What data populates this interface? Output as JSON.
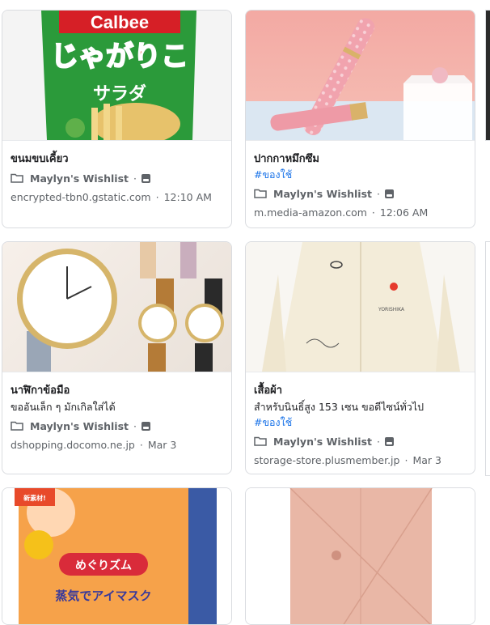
{
  "cards": [
    {
      "title": "ขนมขบเคี้ยว",
      "list_name": "Maylyn's Wishlist",
      "source": "encrypted-tbn0.gstatic.com",
      "time": "12:10 AM"
    },
    {
      "title": "ปากกาหมึกซึม",
      "tag": "#ของใช้",
      "list_name": "Maylyn's Wishlist",
      "source": "m.media-amazon.com",
      "time": "12:06 AM"
    },
    {
      "title": "นาฬิกาข้อมือ",
      "desc": "ขออันเล็ก ๆ มักเกิลใส่ได้",
      "list_name": "Maylyn's Wishlist",
      "source": "dshopping.docomo.ne.jp",
      "time": "Mar 3"
    },
    {
      "title": "เสื้อผ้า",
      "desc": "สำหรับนินธิ์สูง 153 เซน ขอดีไซน์ทั่วไป",
      "tag": "#ของใช้",
      "list_name": "Maylyn's Wishlist",
      "source": "storage-store.plusmember.jp",
      "time": "Mar 3"
    }
  ],
  "images": {
    "calbee_brand": "Calbee",
    "calbee_name": "じゃがりこ",
    "calbee_sub": "サラダ",
    "shirt_print": "YORISHIKA",
    "mask_name": "めぐりズム",
    "mask_text": "蒸気でアイマスク",
    "mask_badge": "新素材!"
  },
  "icons": {
    "folder": "folder-icon",
    "image": "image-icon",
    "note": "note-icon"
  },
  "colors": {
    "tag": "#1a73e8",
    "meta": "#5f6368",
    "border": "#dadce0"
  }
}
